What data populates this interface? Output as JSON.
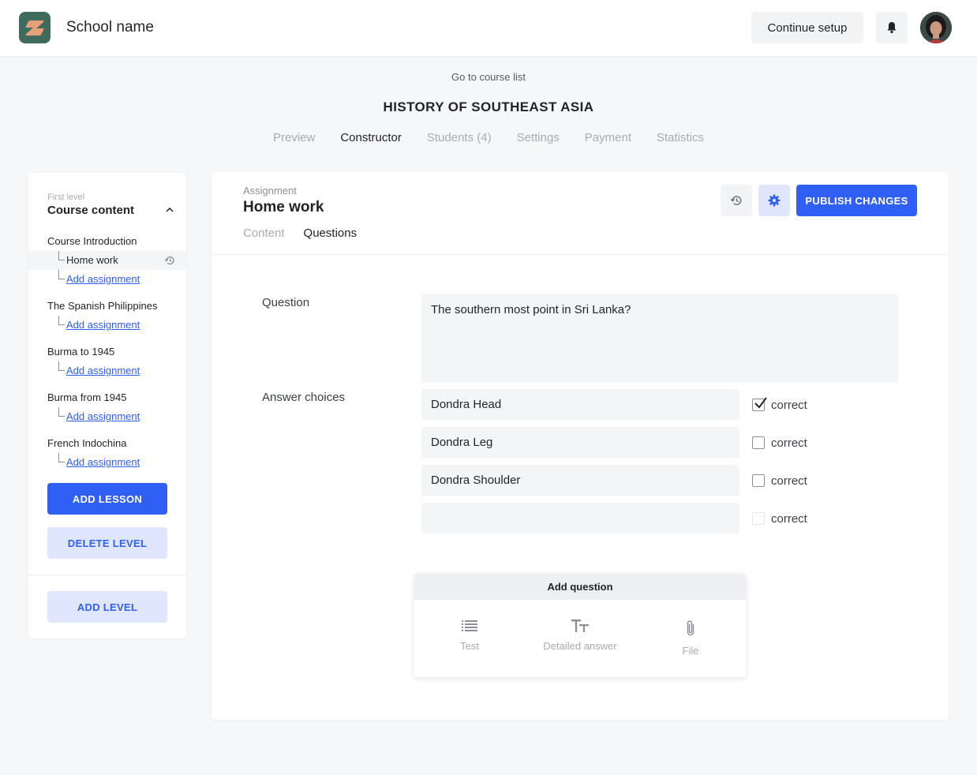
{
  "header": {
    "school_name": "School name",
    "continue_setup": "Continue setup",
    "logo_icon": "school-logo-icon",
    "bell_icon": "bell-icon"
  },
  "course": {
    "back_link": "Go to course list",
    "title": "HISTORY OF SOUTHEAST ASIA",
    "tabs": [
      "Preview",
      "Constructor",
      "Students (4)",
      "Settings",
      "Payment",
      "Statistics"
    ],
    "active_tab": "Constructor"
  },
  "sidebar": {
    "level_caption": "First level",
    "level_title": "Course content",
    "lessons": [
      {
        "title": "Course Introduction",
        "items": [
          "Home work"
        ],
        "add_label": "Add assignment"
      },
      {
        "title": "The Spanish Philippines",
        "items": [],
        "add_label": "Add assignment"
      },
      {
        "title": "Burma to 1945",
        "items": [],
        "add_label": "Add assignment"
      },
      {
        "title": "Burma from 1945",
        "items": [],
        "add_label": "Add assignment"
      },
      {
        "title": "French Indochina",
        "items": [],
        "add_label": "Add assignment"
      }
    ],
    "add_lesson": "ADD LESSON",
    "delete_level": "DELETE LEVEL",
    "add_level": "ADD LEVEL"
  },
  "assignment": {
    "caption": "Assignment",
    "title": "Home work",
    "tabs": [
      "Content",
      "Questions"
    ],
    "active_tab": "Questions",
    "publish": "PUBLISH CHANGES",
    "question_label": "Question",
    "question_text": "The southern most point in Sri Lanka?",
    "answers_label": "Answer choices",
    "answers": [
      {
        "text": "Dondra Head",
        "correct": true
      },
      {
        "text": "Dondra Leg",
        "correct": false
      },
      {
        "text": "Dondra Shoulder",
        "correct": false
      },
      {
        "text": "",
        "correct": false
      }
    ],
    "correct_label": "correct"
  },
  "add_question": {
    "title": "Add question",
    "options": [
      {
        "label": "Test",
        "icon": "list-icon"
      },
      {
        "label": "Detailed answer",
        "icon": "text-format-icon"
      },
      {
        "label": "File",
        "icon": "paperclip-icon"
      }
    ]
  },
  "colors": {
    "accent": "#2f5ff5",
    "accent_soft": "#dfe6fe",
    "background": "#f6f7f9"
  }
}
